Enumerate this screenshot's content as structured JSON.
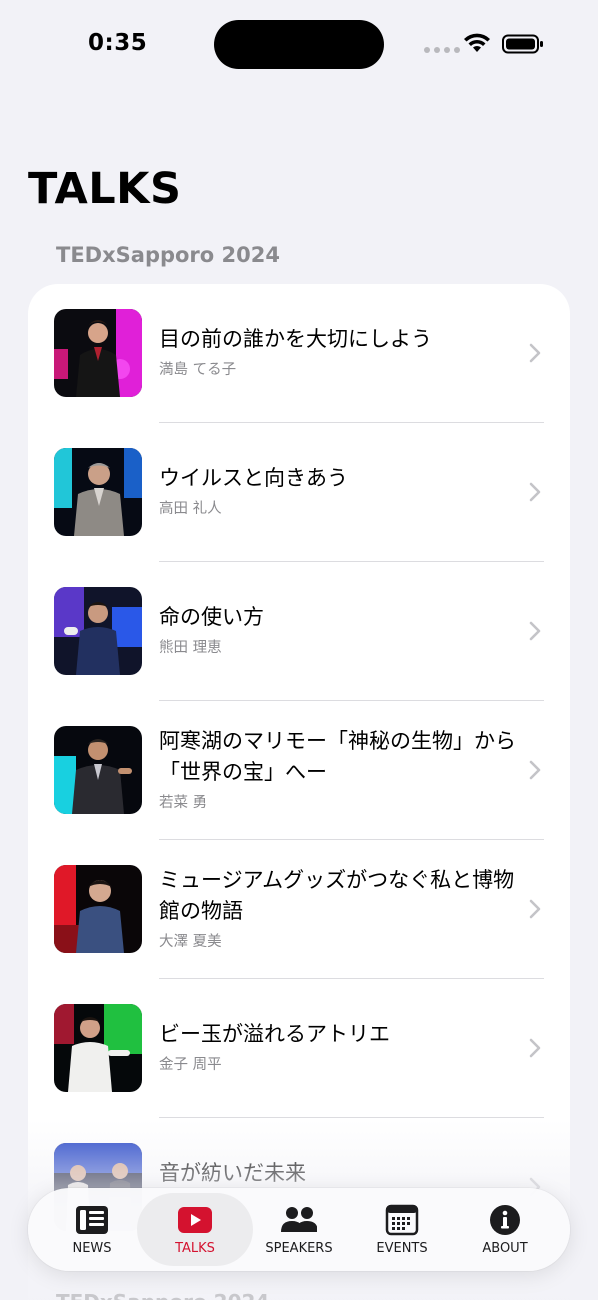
{
  "status_bar": {
    "time": "0:35"
  },
  "page_title": "TALKS",
  "section_header": "TEDxSapporo 2024",
  "talks": [
    {
      "title": "目の前の誰かを大切にしよう",
      "speaker": "満島 てる子"
    },
    {
      "title": "ウイルスと向きあう",
      "speaker": "高田 礼人"
    },
    {
      "title": "命の使い方",
      "speaker": "熊田 理恵"
    },
    {
      "title": "阿寒湖のマリモー「神秘の生物」から「世界の宝」へー",
      "speaker": "若菜 勇"
    },
    {
      "title": "ミュージアムグッズがつなぐ私と博物館の物語",
      "speaker": "大澤 夏美"
    },
    {
      "title": "ビー玉が溢れるアトリエ",
      "speaker": "金子 周平"
    },
    {
      "title": "音が紡いだ未来",
      "speaker": ""
    }
  ],
  "tabs": [
    {
      "label": "NEWS",
      "icon": "newspaper-icon"
    },
    {
      "label": "TALKS",
      "icon": "play-icon"
    },
    {
      "label": "SPEAKERS",
      "icon": "people-icon"
    },
    {
      "label": "EVENTS",
      "icon": "calendar-icon"
    },
    {
      "label": "ABOUT",
      "icon": "info-icon"
    }
  ],
  "active_tab": "TALKS",
  "colors": {
    "accent": "#d4122f",
    "background": "#f2f2f7",
    "card": "#ffffff",
    "secondary_text": "#8a8a8e"
  }
}
